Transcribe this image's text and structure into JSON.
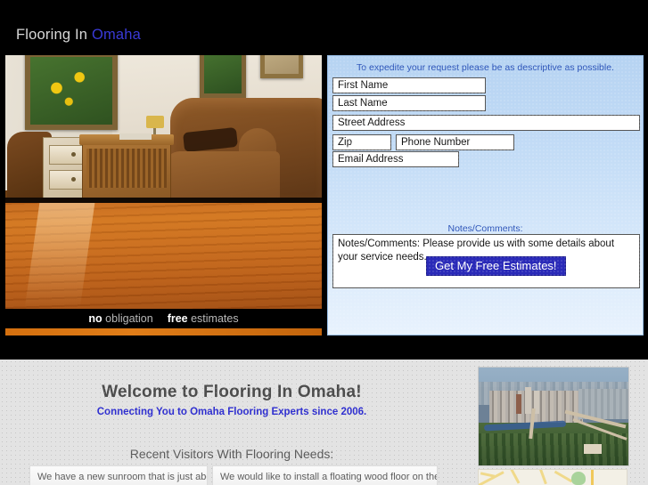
{
  "header": {
    "brand_prefix": "Flooring In ",
    "brand_city": "Omaha"
  },
  "hero": {
    "tag_no": "no",
    "tag_obligation": " obligation",
    "tag_free": "free",
    "tag_estimates": " estimates"
  },
  "quote_form": {
    "heading": "To expedite your request please be as descriptive as possible.",
    "fields": [
      {
        "name": "first-name",
        "placeholder": "First Name",
        "value": ""
      },
      {
        "name": "last-name",
        "placeholder": "Last Name",
        "value": ""
      },
      {
        "name": "street-address",
        "placeholder": "Street Address",
        "value": ""
      },
      {
        "name": "zip",
        "placeholder": "Zip",
        "value": ""
      },
      {
        "name": "phone-number",
        "placeholder": "Phone Number",
        "value": ""
      },
      {
        "name": "email-address",
        "placeholder": "Email Address",
        "value": ""
      }
    ],
    "notes_label": "Notes/Comments:",
    "notes_placeholder": "Notes/Comments: Please provide us with some details about your service needs.",
    "submit_label": "Get My Free Estimates!",
    "accent_color": "#2a2ab8",
    "panel_color": "#c3dcf6",
    "label_color": "#2b53b8"
  },
  "welcome": {
    "title": "Welcome to Flooring In Omaha!",
    "tagline": "Connecting You to Omaha Flooring Experts since 2006.",
    "recent_heading": "Recent Visitors With Flooring Needs:",
    "testimonials": [
      "We have a new sunroom that is just about",
      "We would like to install a floating wood floor on the"
    ]
  }
}
